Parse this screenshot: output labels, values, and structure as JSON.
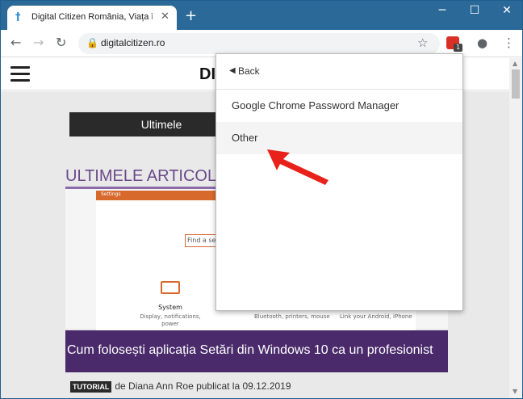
{
  "browser": {
    "tab_title": "Digital Citizen România, Viața în",
    "tab_favicon": "†",
    "new_tab": "+",
    "url": "digitalcitizen.ro",
    "extension_badge": "1",
    "window_controls": {
      "minimize": "─",
      "maximize": "☐",
      "close": "✕"
    }
  },
  "site": {
    "logo": "DI",
    "ultimele_button": "Ultimele",
    "section_title": "ULTIMELE ARTICOLE",
    "article": {
      "image_settings_title": "Settings",
      "image_find": "Find a sett",
      "image_system_title": "System",
      "image_system_desc": "Display, notifications, power",
      "image_bluetooth_desc": "Bluetooth, printers, mouse",
      "image_phone_desc": "Link your Android, iPhone",
      "headline": "Cum folosești aplicația Setări din Windows 10 ca un profesionist",
      "tag": "TUTORIAL",
      "byline": "de Diana Ann Roe publicat la 09.12.2019"
    }
  },
  "popup": {
    "back_label": "Back",
    "items": [
      {
        "label": "Google Chrome Password Manager"
      },
      {
        "label": "Other"
      }
    ]
  },
  "colors": {
    "titlebar": "#2b6a98",
    "annotation_arrow": "#e8211b",
    "headline_bg": "#4a2a6a"
  }
}
